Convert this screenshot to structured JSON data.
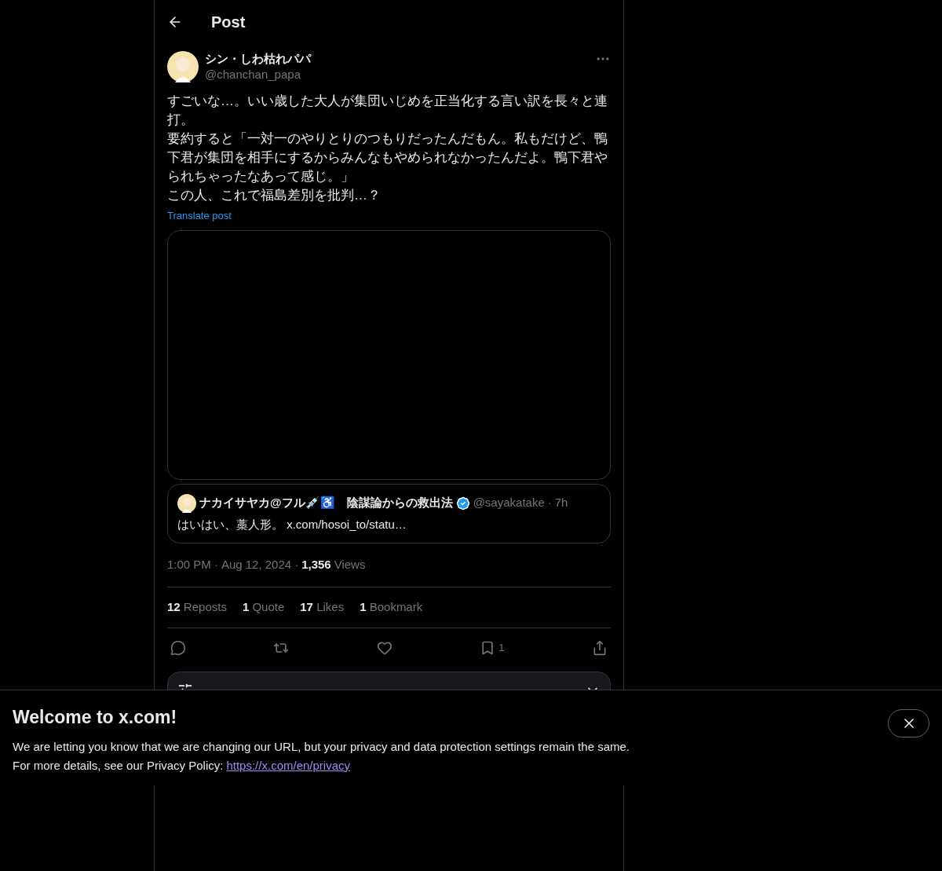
{
  "header": {
    "title": "Post"
  },
  "post": {
    "display_name": "シン・しわ枯れパパ",
    "handle": "@chanchan_papa",
    "lines": [
      "すごいな…。いい歳した大人が集団いじめを正当化する言い訳を長々と連打。",
      "要約すると「一対一のやりとりのつもりだったんだもん。私もだけど、鴨下君が集団を相手にするからみんなもやめられなかったんだよ。鴨下君やられちゃったなあって感じ。」",
      "この人、これで福島差別を批判…？"
    ],
    "translate_link": "Translate post"
  },
  "quote": {
    "display_name": "ナカイサヤカ@フル💉♿　陰謀論からの救出法",
    "verified": true,
    "handle": "@sayakatake",
    "separator": "·",
    "time": "7h",
    "text": "はいはい、藁人形。 x.com/hosoi_to/statu…"
  },
  "meta": {
    "time": "1:00 PM",
    "date": "Aug 12, 2024",
    "views_count": "1,356",
    "views_label": "Views",
    "separator": "·"
  },
  "stats": [
    {
      "count": "12",
      "label": "Reposts"
    },
    {
      "count": "1",
      "label": "Quote"
    },
    {
      "count": "17",
      "label": "Likes"
    },
    {
      "count": "1",
      "label": "Bookmark"
    }
  ],
  "actions": [
    {
      "kind": "reply"
    },
    {
      "kind": "repost"
    },
    {
      "kind": "like"
    },
    {
      "kind": "bookmark",
      "count": "1"
    },
    {
      "kind": "share"
    }
  ],
  "banner": {
    "title": "Welcome to x.com!",
    "line_1": "We are letting you know that we are changing our URL, but your privacy and data protection settings remain the same.",
    "line_2": "For more details, see our Privacy Policy:",
    "link": "https://x.com/en/privacy"
  }
}
